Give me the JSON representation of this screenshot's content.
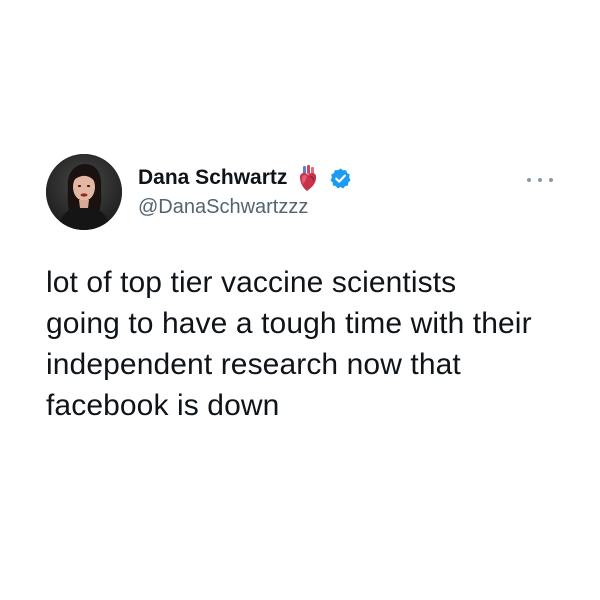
{
  "author": {
    "display_name": "Dana Schwartz",
    "handle": "@DanaSchwartzzz",
    "badges": [
      "anatomical-heart-icon",
      "verified-icon"
    ],
    "verified_color": "#1d9bf0"
  },
  "tweet": {
    "text": "lot of top tier vaccine scientists\ngoing to have a tough time with their\nindependent research now that\nfacebook is down"
  },
  "menu": {
    "icon": "more-horizontal-icon"
  },
  "colors": {
    "text_primary": "#0f1419",
    "text_secondary": "#536471",
    "background": "#ffffff"
  }
}
